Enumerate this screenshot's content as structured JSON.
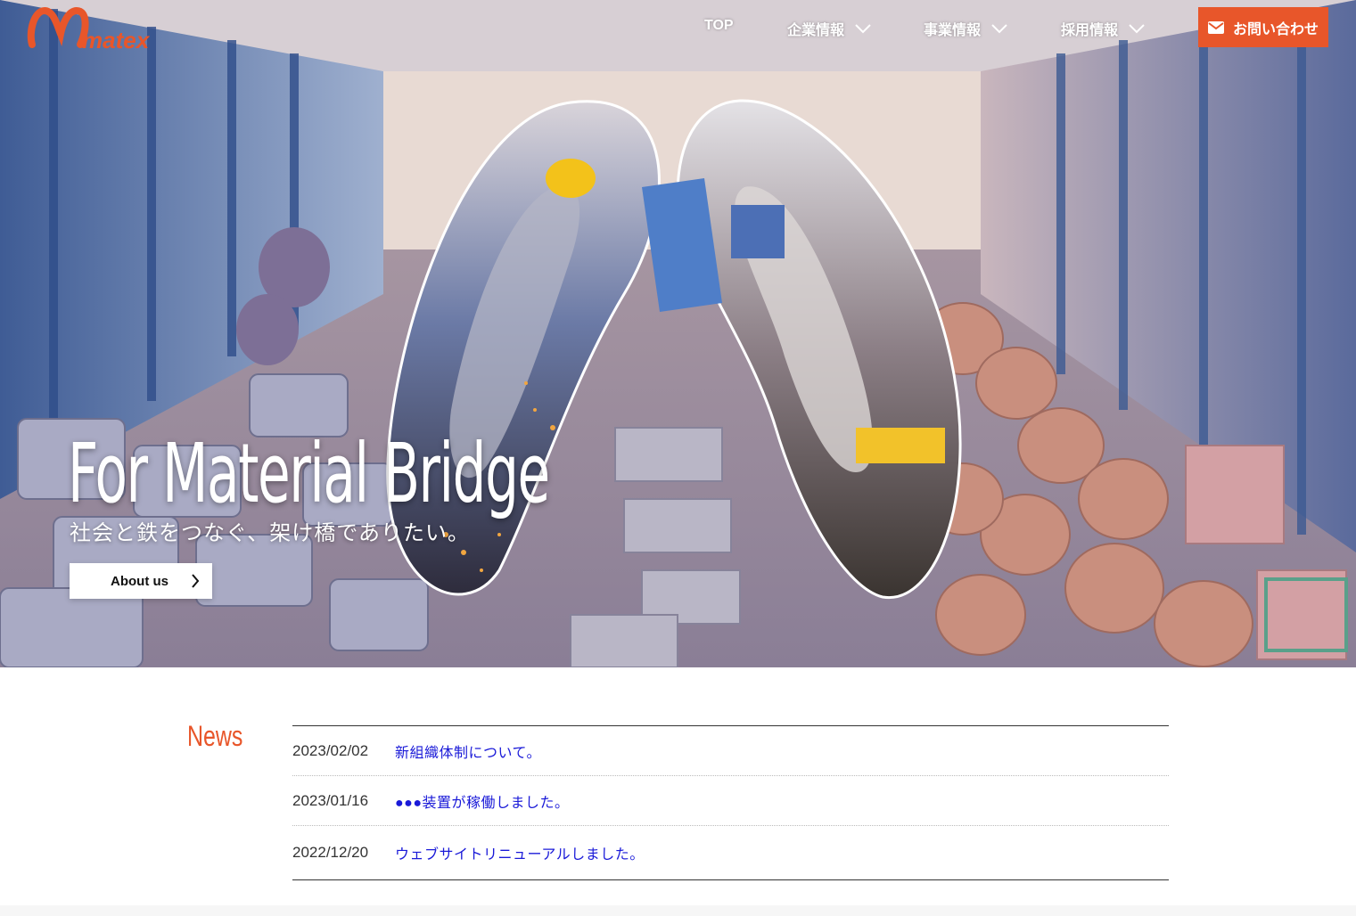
{
  "brand": {
    "logo_text": "matex",
    "accent_color": "#e8562a"
  },
  "nav": {
    "items": [
      {
        "label": "TOP"
      },
      {
        "label": "企業情報",
        "has_dropdown": true
      },
      {
        "label": "事業情報",
        "has_dropdown": true
      },
      {
        "label": "採用情報",
        "has_dropdown": true
      }
    ],
    "contact_label": "お問い合わせ",
    "contact_icon": "envelope-icon"
  },
  "hero": {
    "headline": "For Material Bridge",
    "subline": "社会と鉄をつなぐ、架け橋でありたい。",
    "cta_label": "About us"
  },
  "news": {
    "title": "News",
    "items": [
      {
        "date": "2023/02/02",
        "text": "新組織体制について。"
      },
      {
        "date": "2023/01/16",
        "text": "●●●装置が稼働しました。"
      },
      {
        "date": "2022/12/20",
        "text": "ウェブサイトリニューアルしました。"
      }
    ]
  }
}
